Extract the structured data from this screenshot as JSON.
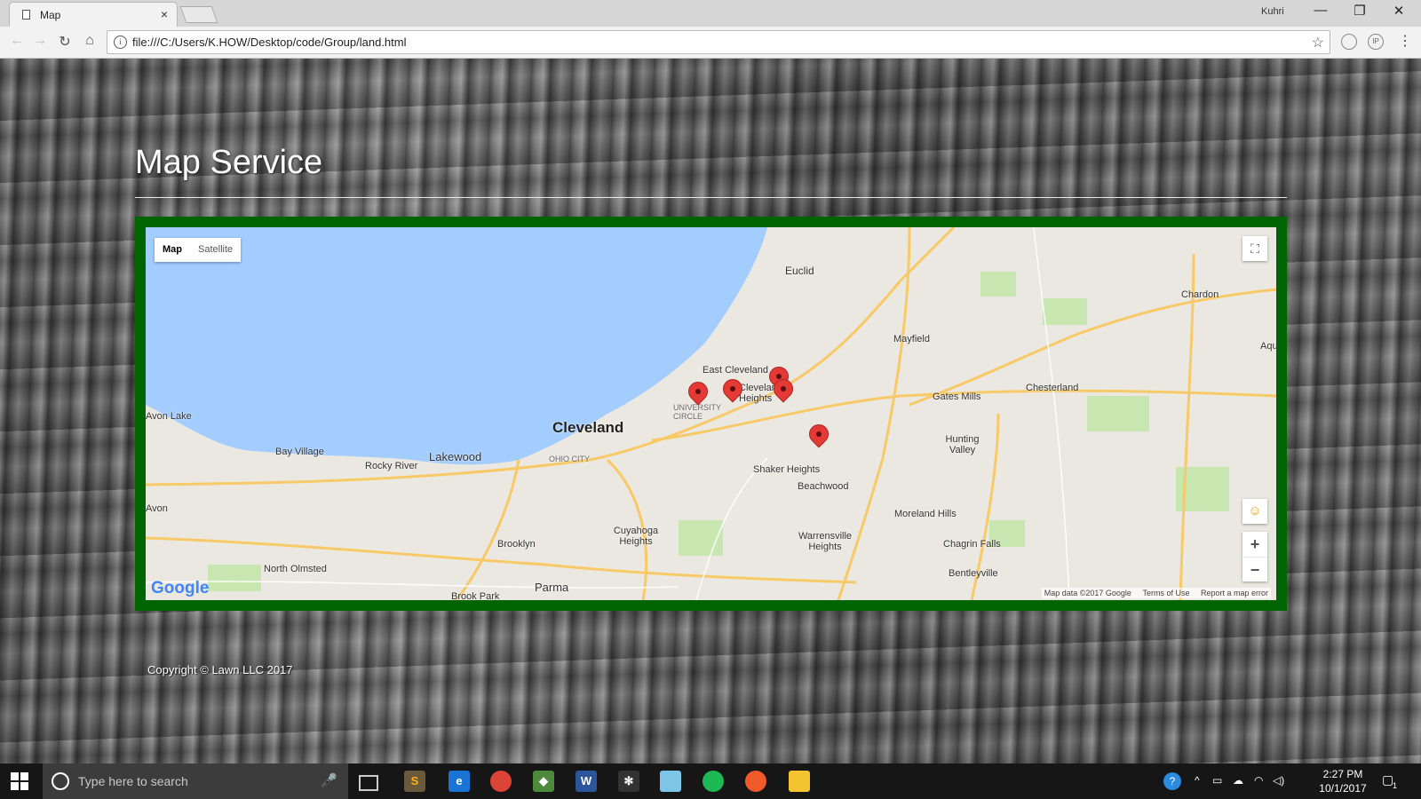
{
  "browser": {
    "tab_title": "Map",
    "tab_close": "×",
    "user_name": "Kuhri",
    "url": "file:///C:/Users/K.HOW/Desktop/code/Group/land.html",
    "window_min": "—",
    "window_restore": "❐",
    "window_close": "✕",
    "back": "←",
    "forward": "→",
    "reload": "↻",
    "home": "⌂",
    "star": "☆",
    "menu": "⋮",
    "ext1": "",
    "ext2": "IP"
  },
  "page": {
    "heading": "Map Service",
    "footer": "Copyright © Lawn LLC 2017"
  },
  "map": {
    "map_type_map": "Map",
    "map_type_satellite": "Satellite",
    "fullscreen_glyph": "⛶",
    "pegman_glyph": "☺",
    "zoom_in": "+",
    "zoom_out": "−",
    "google": "Google",
    "attribution": "Map data ©2017 Google",
    "terms": "Terms of Use",
    "report": "Report a map error",
    "labels": {
      "euclid": "Euclid",
      "chardon": "Chardon",
      "mayfield": "Mayfield",
      "east_cleveland": "East Cleveland",
      "cleveland_heights": "Cleveland Heights",
      "university_circle": "UNIVERSITY CIRCLE",
      "cleveland": "Cleveland",
      "ohio_city": "OHIO CITY",
      "lakewood": "Lakewood",
      "avon_lake": "Avon Lake",
      "bay_village": "Bay Village",
      "rocky_river": "Rocky River",
      "avon": "Avon",
      "shaker_heights": "Shaker Heights",
      "beachwood": "Beachwood",
      "gates_mills": "Gates Mills",
      "chesterland": "Chesterland",
      "hunting_valley": "Hunting Valley",
      "moreland_hills": "Moreland Hills",
      "chagrin_falls": "Chagrin Falls",
      "bentleyville": "Bentleyville",
      "warrensville_heights": "Warrensville Heights",
      "cuyahoga_heights": "Cuyahoga Heights",
      "brooklyn": "Brooklyn",
      "parma": "Parma",
      "north_olmsted": "North Olmsted",
      "brook_park": "Brook Park",
      "aqu": "Aqu"
    }
  },
  "taskbar": {
    "search_placeholder": "Type here to search",
    "mic": "🎤",
    "time": "2:27 PM",
    "date": "10/1/2017",
    "notification_count": "1"
  },
  "colors": {
    "map_frame": "#006400",
    "water": "#a3ccff",
    "pin": "#e53935"
  }
}
